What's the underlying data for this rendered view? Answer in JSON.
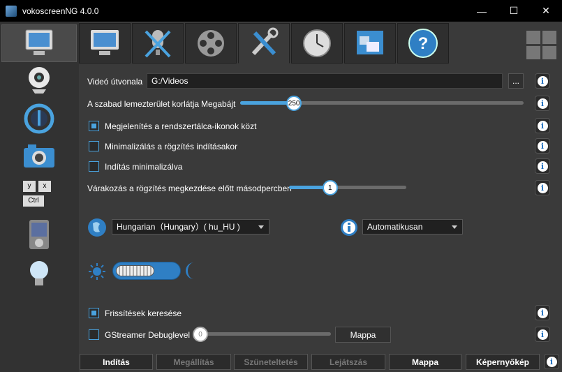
{
  "window": {
    "title": "vokoscreenNG 4.0.0",
    "min": "—",
    "max": "☐",
    "close": "✕"
  },
  "sidebar": {
    "items": [
      "screencast-icon",
      "webcam-icon",
      "magnifier-icon",
      "snapshot-icon",
      "hotkeys-icon",
      "player-icon",
      "lightbulb-icon"
    ],
    "hotkeys": {
      "y": "y",
      "x": "x",
      "ctrl": "Ctrl"
    }
  },
  "tabs": [
    "screen-tab",
    "audio-tab",
    "video-tab",
    "settings-tab",
    "timer-tab",
    "misc-tab",
    "help-tab"
  ],
  "settings": {
    "video_path_label": "Videó útvonala",
    "video_path_value": "G:/Videos",
    "browse_label": "...",
    "free_space_label": "A szabad lemezterület korlátja",
    "free_space_unit": "Megabájt",
    "free_space_value": "250",
    "free_space_fraction": 0.19,
    "systray_label": "Megjelenítés a rendszertálca-ikonok közt",
    "systray_checked": true,
    "minimize_label": "Minimalizálás a rögzítés indításakor",
    "minimize_checked": false,
    "start_min_label": "Indítás minimalizálva",
    "start_min_checked": false,
    "countdown_label": "Várakozás a rögzítés megkezdése előtt másodpercben",
    "countdown_value": "1",
    "countdown_fraction": 0.35,
    "language_value": "Hungarian（Hungary）( hu_HU )",
    "style_value": "Automatikusan",
    "theme_toggle_fraction": 0.62,
    "updates_label": "Frissítések keresése",
    "updates_checked": true,
    "gst_label": "GStreamer Debuglevel",
    "gst_value": "0",
    "gst_fraction": 0.0,
    "folder_label": "Mappa"
  },
  "bottom": {
    "start": "Indítás",
    "stop": "Megállítás",
    "pause": "Szüneteltetés",
    "play": "Lejátszás",
    "folder": "Mappa",
    "screenshot": "Képernyőkép"
  },
  "info_glyph": "i",
  "colors": {
    "accent": "#4aa3df",
    "background": "#3a3a3a",
    "titlebar": "#000000"
  }
}
